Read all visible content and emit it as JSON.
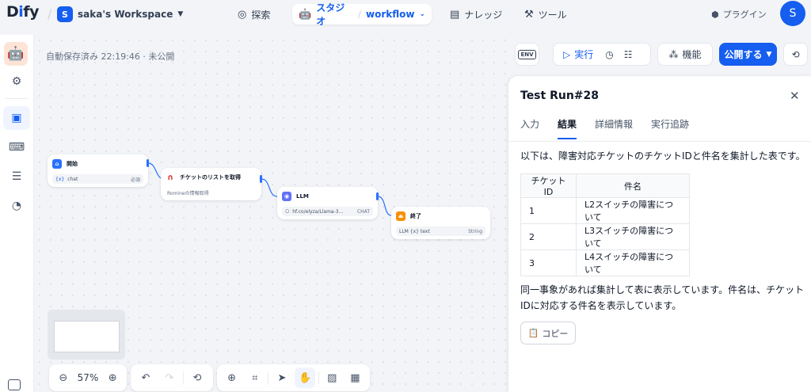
{
  "header": {
    "logo": "Dify",
    "workspace": {
      "initial": "S",
      "name": "saka's Workspace"
    },
    "nav": {
      "explore": "探索",
      "studio": "スタジオ",
      "studio_app": "workflow",
      "knowledge": "ナレッジ",
      "tools": "ツール"
    },
    "plugins": "プラグイン",
    "user_initial": "S"
  },
  "canvas": {
    "autosave": "自動保存済み 22:19:46 · 未公開",
    "nodes": {
      "start": {
        "title": "開始",
        "var": "chat",
        "tag": "必須"
      },
      "ticket": {
        "title": "チケットのリストを取得",
        "desc": "Romineの情報取得"
      },
      "llm": {
        "title": "LLM",
        "model": "hf.co/elyza/Llama-3...",
        "mode": "CHAT"
      },
      "end": {
        "title": "終了",
        "var": "LLM {x} text",
        "type": "String"
      }
    },
    "zoom": "57%"
  },
  "toolbar": {
    "run": "実行",
    "features": "機能",
    "publish": "公開する",
    "env": "ENV"
  },
  "panel": {
    "title": "Test Run#28",
    "tabs": [
      "入力",
      "結果",
      "詳細情報",
      "実行追跡"
    ],
    "active_tab": 1,
    "intro": "以下は、障害対応チケットのチケットIDと件名を集計した表です。",
    "table": {
      "headers": [
        "チケットID",
        "件名"
      ],
      "rows": [
        [
          "1",
          "L2スイッチの障害について"
        ],
        [
          "2",
          "L3スイッチの障害について"
        ],
        [
          "3",
          "L4スイッチの障害について"
        ]
      ]
    },
    "outro": "同一事象があれば集計して表に表示しています。件名は、チケットIDに対応する件名を表示しています。",
    "copy": "コピー"
  },
  "colors": {
    "accent": "#155eef",
    "start": "#2970ff",
    "llm": "#6172f3",
    "end": "#f79009",
    "ticket": "#d92d20"
  }
}
